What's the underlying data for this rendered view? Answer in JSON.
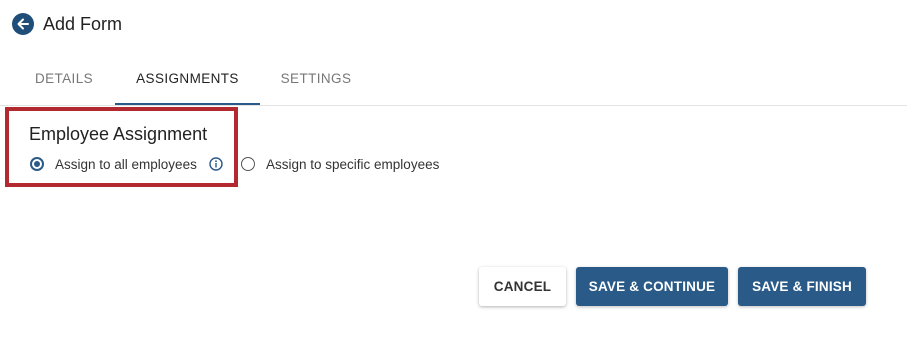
{
  "header": {
    "title": "Add Form",
    "back_icon": "arrow-left-circle"
  },
  "tabs": [
    {
      "label": "DETAILS",
      "active": false
    },
    {
      "label": "ASSIGNMENTS",
      "active": true
    },
    {
      "label": "SETTINGS",
      "active": false
    }
  ],
  "assignment": {
    "title": "Employee Assignment",
    "options": [
      {
        "label": "Assign to all employees",
        "selected": true
      },
      {
        "label": "Assign to specific employees",
        "selected": false
      }
    ],
    "info_icon": "info-circle"
  },
  "buttons": {
    "cancel": "CANCEL",
    "save_continue": "SAVE & CONTINUE",
    "save_finish": "SAVE & FINISH"
  },
  "colors": {
    "primary": "#2a5a87",
    "back_button": "#1f4e79",
    "highlight": "#b22a2f",
    "tab_inactive": "#777777"
  }
}
